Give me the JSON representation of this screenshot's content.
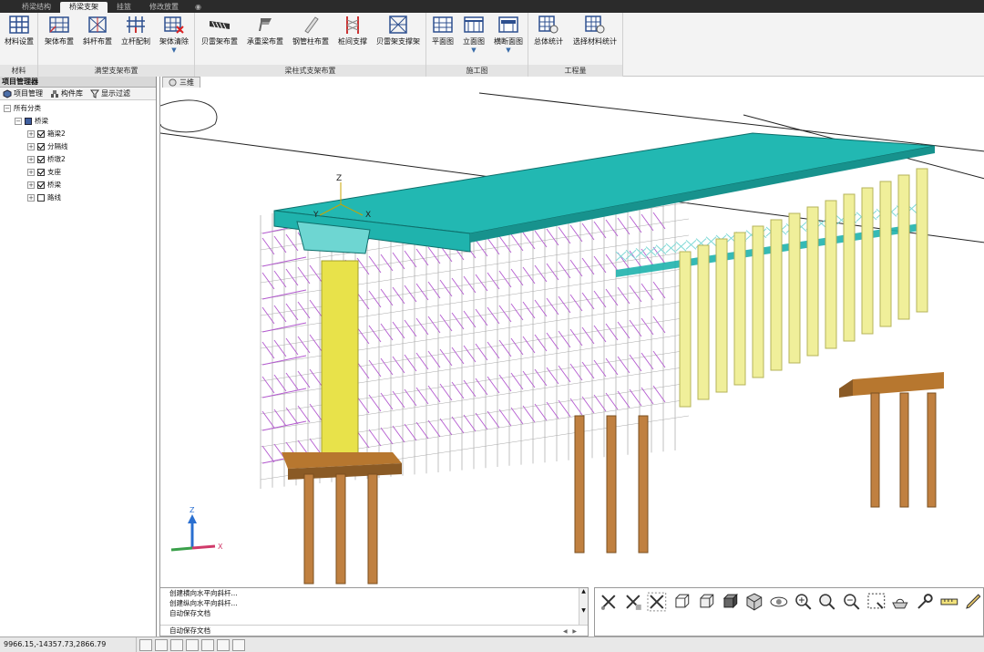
{
  "tabs": [
    {
      "label": "桥梁结构",
      "active": false
    },
    {
      "label": "桥梁支架",
      "active": true
    },
    {
      "label": "挂篮",
      "active": false
    },
    {
      "label": "修改放置",
      "active": false
    }
  ],
  "tab_extra": "◉",
  "ribbon": {
    "groups": [
      {
        "label": "材料",
        "buttons": [
          {
            "label": "材料设置",
            "icon": "grid-icon"
          }
        ]
      },
      {
        "label": "满堂支架布置",
        "buttons": [
          {
            "label": "架体布置",
            "icon": "frame-layout-icon"
          },
          {
            "label": "斜杆布置",
            "icon": "diagonal-bar-icon"
          },
          {
            "label": "立杆配制",
            "icon": "upright-config-icon"
          },
          {
            "label": "架体清除",
            "icon": "frame-clear-icon",
            "dropdown": "▼"
          }
        ]
      },
      {
        "label": "梁柱式支架布置",
        "buttons": [
          {
            "label": "贝雷架布置",
            "icon": "bailey-truss-icon"
          },
          {
            "label": "承重梁布置",
            "icon": "bearing-beam-icon"
          },
          {
            "label": "钢管柱布置",
            "icon": "steel-pipe-icon"
          },
          {
            "label": "桩间支撑",
            "icon": "pile-brace-icon"
          },
          {
            "label": "贝雷架支撑架",
            "icon": "bailey-support-icon"
          }
        ]
      },
      {
        "label": "施工图",
        "buttons": [
          {
            "label": "平面图",
            "icon": "plan-view-icon"
          },
          {
            "label": "立面图",
            "icon": "elevation-view-icon",
            "dropdown": "▼"
          },
          {
            "label": "横断面图",
            "icon": "cross-section-icon",
            "dropdown": "▼"
          }
        ]
      },
      {
        "label": "工程量",
        "buttons": [
          {
            "label": "总体统计",
            "icon": "overall-stats-icon"
          },
          {
            "label": "选择材料统计",
            "icon": "material-stats-icon"
          }
        ]
      }
    ]
  },
  "left_panel": {
    "title": "项目管理器",
    "tabs": [
      "项目管理",
      "构件库",
      "显示过滤"
    ],
    "tree": {
      "root": "所有分类",
      "group": "桥梁",
      "items": [
        {
          "label": "箱梁2",
          "checked": true
        },
        {
          "label": "分隔线",
          "checked": true
        },
        {
          "label": "桥墩2",
          "checked": true
        },
        {
          "label": "支座",
          "checked": true
        },
        {
          "label": "桥梁",
          "checked": true
        },
        {
          "label": "路线",
          "checked": false
        }
      ]
    }
  },
  "viewport": {
    "tab_label": "三维",
    "axis_labels": {
      "x": "X",
      "y": "Y",
      "z": "Z"
    }
  },
  "command_log": {
    "lines": [
      "创建横向水平向斜杆...",
      "创建纵向水平向斜杆...",
      "自动保存文档"
    ],
    "input": "自动保存文档"
  },
  "view_tools": [
    "select-icon",
    "select-cross-icon",
    "select-window-icon",
    "wireframe-cube-icon",
    "hidden-cube-icon",
    "shaded-cube-icon",
    "iso-view-icon",
    "orbit-icon",
    "zoom-extent-icon",
    "zoom-icon",
    "zoom-window-icon",
    "pan-icon",
    "measure-icon",
    "settings-wrench-icon",
    "ruler-icon",
    "pencil-icon"
  ],
  "status_bar": {
    "coords": "9966.15,-14357.73,2866.79"
  },
  "colors": {
    "deck": "#1fb3ad",
    "deck_top": "#22b8b2",
    "pier": "#e8e24a",
    "pile": "#c08040",
    "scaffold": "#b45ad0",
    "truss": "#7fd9d6",
    "pipe_column": "#f0ef9a"
  }
}
